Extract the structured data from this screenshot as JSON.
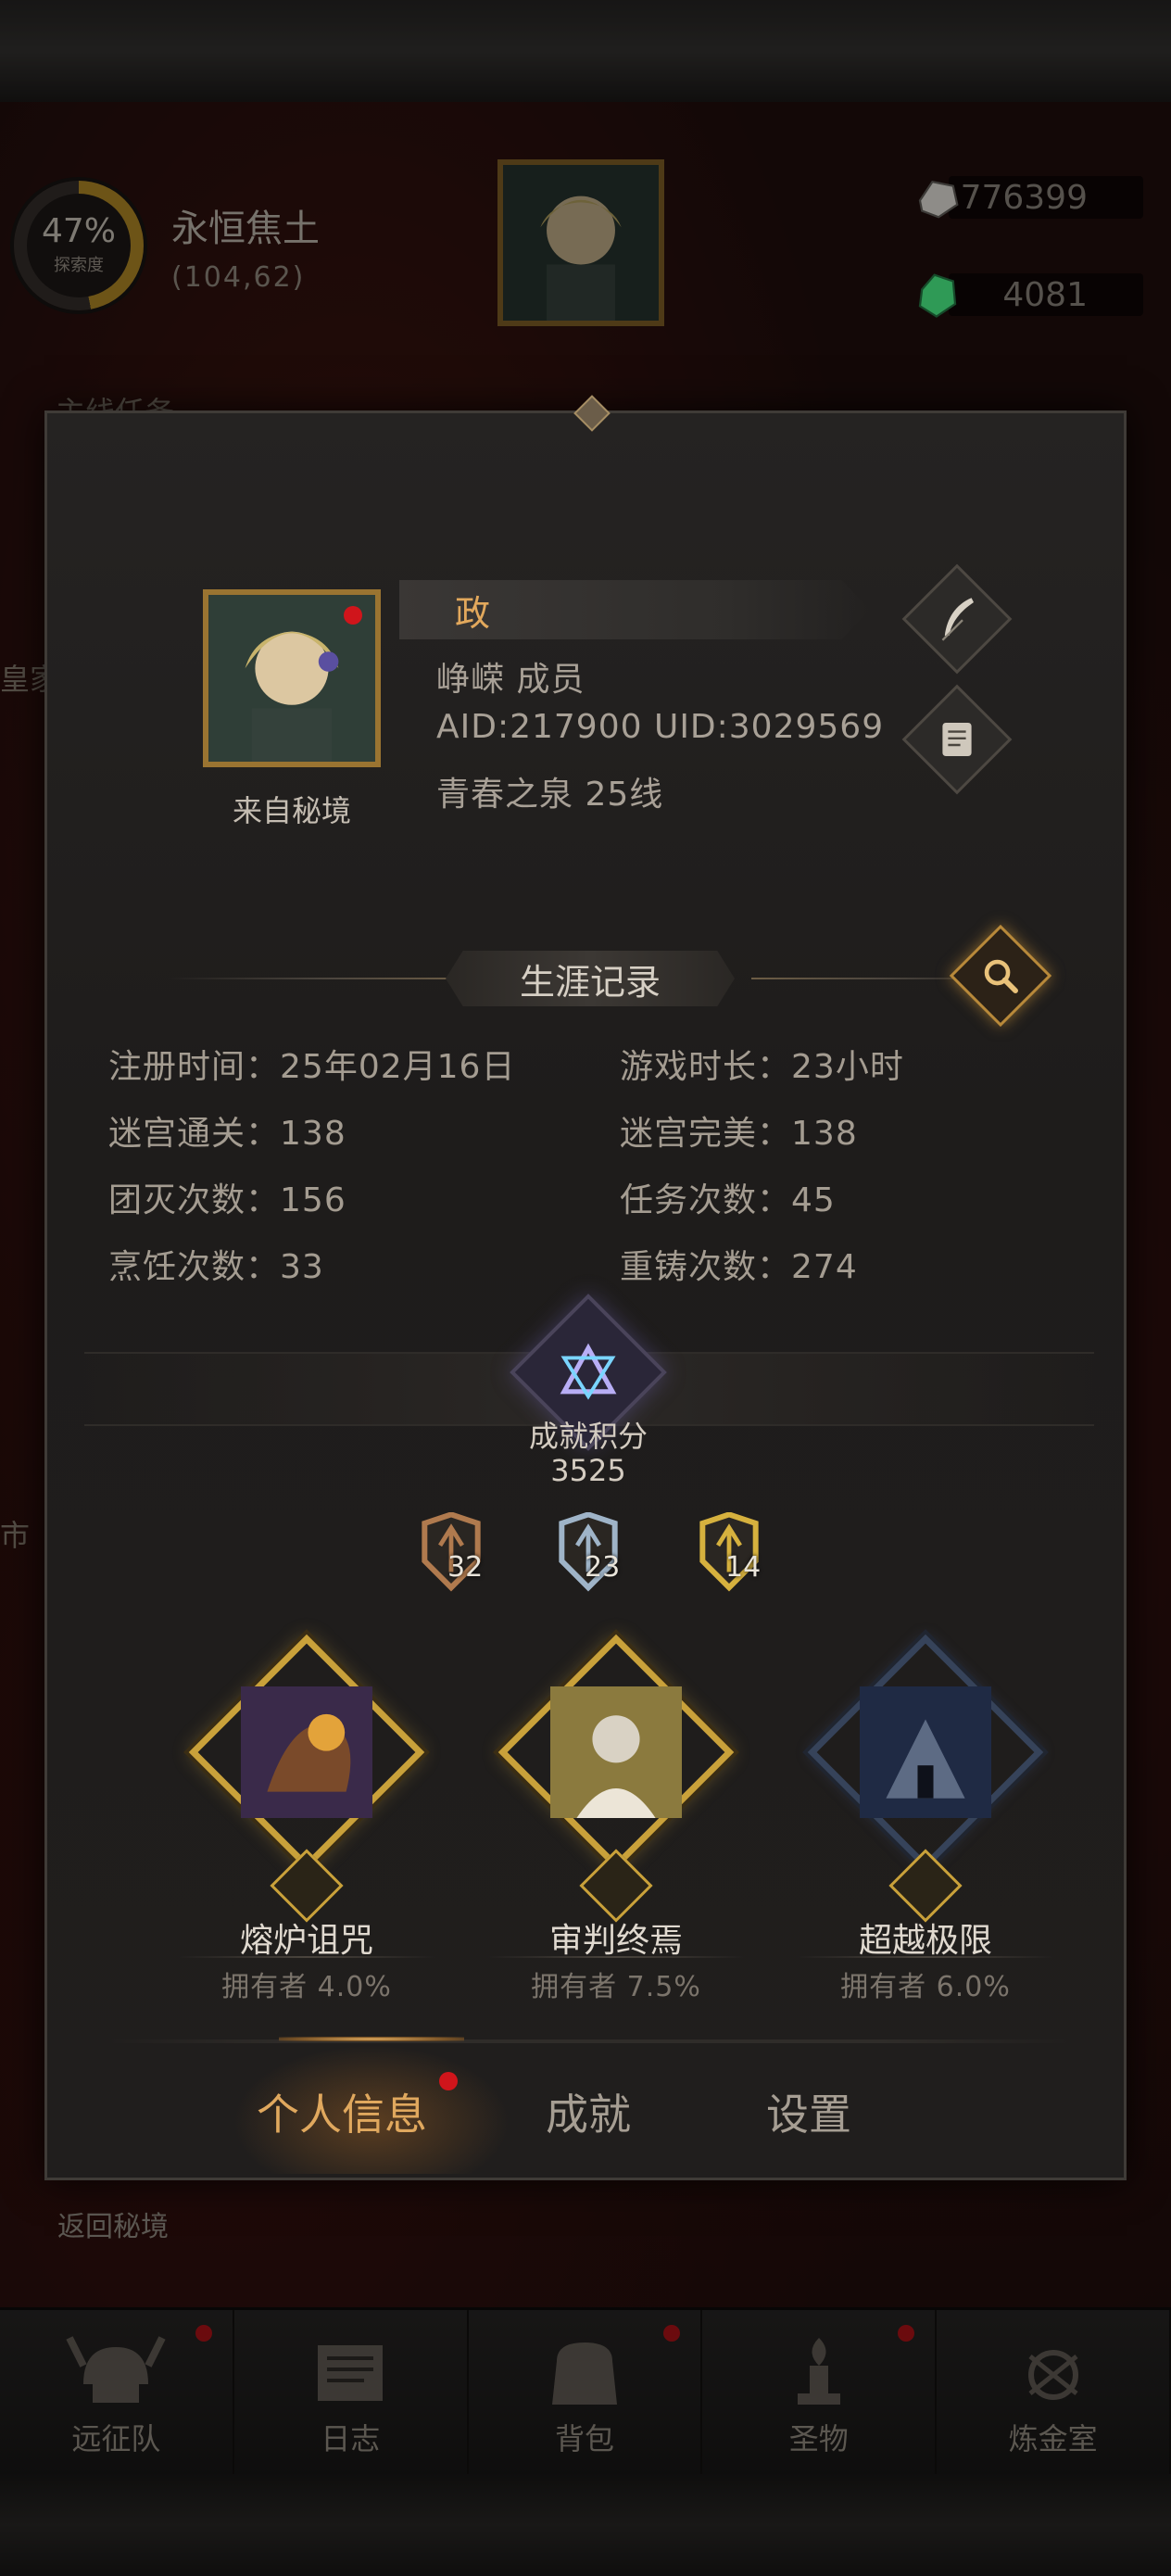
{
  "hud": {
    "explore_percent": "47%",
    "explore_label": "探索度",
    "region_name": "永恒焦土",
    "region_coord": "(104,62)",
    "currency_1": "776399",
    "currency_2": "4081",
    "side_text_1": "主线任务",
    "side_text_2": "皇家",
    "side_text_3": "市",
    "return_label": "返回秘境"
  },
  "nav": {
    "items": [
      {
        "label": "远征队",
        "icon": "helmet-icon",
        "dot": true
      },
      {
        "label": "日志",
        "icon": "journal-icon",
        "dot": false
      },
      {
        "label": "背包",
        "icon": "bag-icon",
        "dot": true
      },
      {
        "label": "圣物",
        "icon": "relic-icon",
        "dot": true
      },
      {
        "label": "炼金室",
        "icon": "alchemy-icon",
        "dot": false
      }
    ]
  },
  "profile": {
    "name": "政",
    "guild_line": "峥嵘  成员",
    "ids_line": "AID:217900 UID:3029569",
    "server_line": "青春之泉  25线",
    "portrait_caption": "来自秘境"
  },
  "career": {
    "title": "生涯记录",
    "stats": [
      {
        "label": "注册时间：",
        "value": "25年02月16日"
      },
      {
        "label": "游戏时长：",
        "value": "23小时"
      },
      {
        "label": "迷宫通关：",
        "value": "138"
      },
      {
        "label": "迷宫完美：",
        "value": "138"
      },
      {
        "label": "团灭次数：",
        "value": "156"
      },
      {
        "label": "任务次数：",
        "value": "45"
      },
      {
        "label": "烹饪次数：",
        "value": "33"
      },
      {
        "label": "重铸次数：",
        "value": "274"
      }
    ]
  },
  "achievement": {
    "label": "成就积分",
    "score": "3525",
    "medals": [
      {
        "tier": "bronze",
        "count": "32",
        "color": "#b07a4e"
      },
      {
        "tier": "silver",
        "count": "23",
        "color": "#9fb4c8"
      },
      {
        "tier": "gold",
        "count": "14",
        "color": "#d6b13e"
      }
    ],
    "badges": [
      {
        "title": "熔炉诅咒",
        "owners": "拥有者  4.0%"
      },
      {
        "title": "审判终焉",
        "owners": "拥有者  7.5%"
      },
      {
        "title": "超越极限",
        "owners": "拥有者  6.0%"
      }
    ]
  },
  "tabs": [
    {
      "label": "个人信息",
      "active": true
    },
    {
      "label": "成就",
      "active": false
    },
    {
      "label": "设置",
      "active": false
    }
  ]
}
